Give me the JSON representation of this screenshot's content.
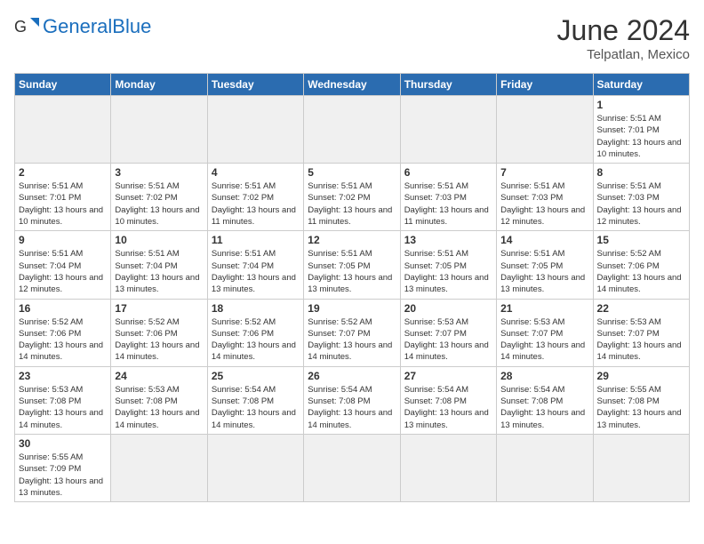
{
  "header": {
    "logo_general": "General",
    "logo_blue": "Blue",
    "month": "June 2024",
    "location": "Telpatlan, Mexico"
  },
  "weekdays": [
    "Sunday",
    "Monday",
    "Tuesday",
    "Wednesday",
    "Thursday",
    "Friday",
    "Saturday"
  ],
  "weeks": [
    [
      {
        "day": "",
        "empty": true
      },
      {
        "day": "",
        "empty": true
      },
      {
        "day": "",
        "empty": true
      },
      {
        "day": "",
        "empty": true
      },
      {
        "day": "",
        "empty": true
      },
      {
        "day": "",
        "empty": true
      },
      {
        "day": "1",
        "sunrise": "Sunrise: 5:51 AM",
        "sunset": "Sunset: 7:01 PM",
        "daylight": "Daylight: 13 hours and 10 minutes."
      }
    ],
    [
      {
        "day": "2",
        "sunrise": "Sunrise: 5:51 AM",
        "sunset": "Sunset: 7:01 PM",
        "daylight": "Daylight: 13 hours and 10 minutes."
      },
      {
        "day": "3",
        "sunrise": "Sunrise: 5:51 AM",
        "sunset": "Sunset: 7:02 PM",
        "daylight": "Daylight: 13 hours and 10 minutes."
      },
      {
        "day": "4",
        "sunrise": "Sunrise: 5:51 AM",
        "sunset": "Sunset: 7:02 PM",
        "daylight": "Daylight: 13 hours and 11 minutes."
      },
      {
        "day": "5",
        "sunrise": "Sunrise: 5:51 AM",
        "sunset": "Sunset: 7:02 PM",
        "daylight": "Daylight: 13 hours and 11 minutes."
      },
      {
        "day": "6",
        "sunrise": "Sunrise: 5:51 AM",
        "sunset": "Sunset: 7:03 PM",
        "daylight": "Daylight: 13 hours and 11 minutes."
      },
      {
        "day": "7",
        "sunrise": "Sunrise: 5:51 AM",
        "sunset": "Sunset: 7:03 PM",
        "daylight": "Daylight: 13 hours and 12 minutes."
      },
      {
        "day": "8",
        "sunrise": "Sunrise: 5:51 AM",
        "sunset": "Sunset: 7:03 PM",
        "daylight": "Daylight: 13 hours and 12 minutes."
      }
    ],
    [
      {
        "day": "9",
        "sunrise": "Sunrise: 5:51 AM",
        "sunset": "Sunset: 7:04 PM",
        "daylight": "Daylight: 13 hours and 12 minutes."
      },
      {
        "day": "10",
        "sunrise": "Sunrise: 5:51 AM",
        "sunset": "Sunset: 7:04 PM",
        "daylight": "Daylight: 13 hours and 13 minutes."
      },
      {
        "day": "11",
        "sunrise": "Sunrise: 5:51 AM",
        "sunset": "Sunset: 7:04 PM",
        "daylight": "Daylight: 13 hours and 13 minutes."
      },
      {
        "day": "12",
        "sunrise": "Sunrise: 5:51 AM",
        "sunset": "Sunset: 7:05 PM",
        "daylight": "Daylight: 13 hours and 13 minutes."
      },
      {
        "day": "13",
        "sunrise": "Sunrise: 5:51 AM",
        "sunset": "Sunset: 7:05 PM",
        "daylight": "Daylight: 13 hours and 13 minutes."
      },
      {
        "day": "14",
        "sunrise": "Sunrise: 5:51 AM",
        "sunset": "Sunset: 7:05 PM",
        "daylight": "Daylight: 13 hours and 13 minutes."
      },
      {
        "day": "15",
        "sunrise": "Sunrise: 5:52 AM",
        "sunset": "Sunset: 7:06 PM",
        "daylight": "Daylight: 13 hours and 14 minutes."
      }
    ],
    [
      {
        "day": "16",
        "sunrise": "Sunrise: 5:52 AM",
        "sunset": "Sunset: 7:06 PM",
        "daylight": "Daylight: 13 hours and 14 minutes."
      },
      {
        "day": "17",
        "sunrise": "Sunrise: 5:52 AM",
        "sunset": "Sunset: 7:06 PM",
        "daylight": "Daylight: 13 hours and 14 minutes."
      },
      {
        "day": "18",
        "sunrise": "Sunrise: 5:52 AM",
        "sunset": "Sunset: 7:06 PM",
        "daylight": "Daylight: 13 hours and 14 minutes."
      },
      {
        "day": "19",
        "sunrise": "Sunrise: 5:52 AM",
        "sunset": "Sunset: 7:07 PM",
        "daylight": "Daylight: 13 hours and 14 minutes."
      },
      {
        "day": "20",
        "sunrise": "Sunrise: 5:53 AM",
        "sunset": "Sunset: 7:07 PM",
        "daylight": "Daylight: 13 hours and 14 minutes."
      },
      {
        "day": "21",
        "sunrise": "Sunrise: 5:53 AM",
        "sunset": "Sunset: 7:07 PM",
        "daylight": "Daylight: 13 hours and 14 minutes."
      },
      {
        "day": "22",
        "sunrise": "Sunrise: 5:53 AM",
        "sunset": "Sunset: 7:07 PM",
        "daylight": "Daylight: 13 hours and 14 minutes."
      }
    ],
    [
      {
        "day": "23",
        "sunrise": "Sunrise: 5:53 AM",
        "sunset": "Sunset: 7:08 PM",
        "daylight": "Daylight: 13 hours and 14 minutes."
      },
      {
        "day": "24",
        "sunrise": "Sunrise: 5:53 AM",
        "sunset": "Sunset: 7:08 PM",
        "daylight": "Daylight: 13 hours and 14 minutes."
      },
      {
        "day": "25",
        "sunrise": "Sunrise: 5:54 AM",
        "sunset": "Sunset: 7:08 PM",
        "daylight": "Daylight: 13 hours and 14 minutes."
      },
      {
        "day": "26",
        "sunrise": "Sunrise: 5:54 AM",
        "sunset": "Sunset: 7:08 PM",
        "daylight": "Daylight: 13 hours and 14 minutes."
      },
      {
        "day": "27",
        "sunrise": "Sunrise: 5:54 AM",
        "sunset": "Sunset: 7:08 PM",
        "daylight": "Daylight: 13 hours and 13 minutes."
      },
      {
        "day": "28",
        "sunrise": "Sunrise: 5:54 AM",
        "sunset": "Sunset: 7:08 PM",
        "daylight": "Daylight: 13 hours and 13 minutes."
      },
      {
        "day": "29",
        "sunrise": "Sunrise: 5:55 AM",
        "sunset": "Sunset: 7:08 PM",
        "daylight": "Daylight: 13 hours and 13 minutes."
      }
    ],
    [
      {
        "day": "30",
        "sunrise": "Sunrise: 5:55 AM",
        "sunset": "Sunset: 7:09 PM",
        "daylight": "Daylight: 13 hours and 13 minutes."
      },
      {
        "day": "",
        "empty": true
      },
      {
        "day": "",
        "empty": true
      },
      {
        "day": "",
        "empty": true
      },
      {
        "day": "",
        "empty": true
      },
      {
        "day": "",
        "empty": true
      },
      {
        "day": "",
        "empty": true
      }
    ]
  ]
}
